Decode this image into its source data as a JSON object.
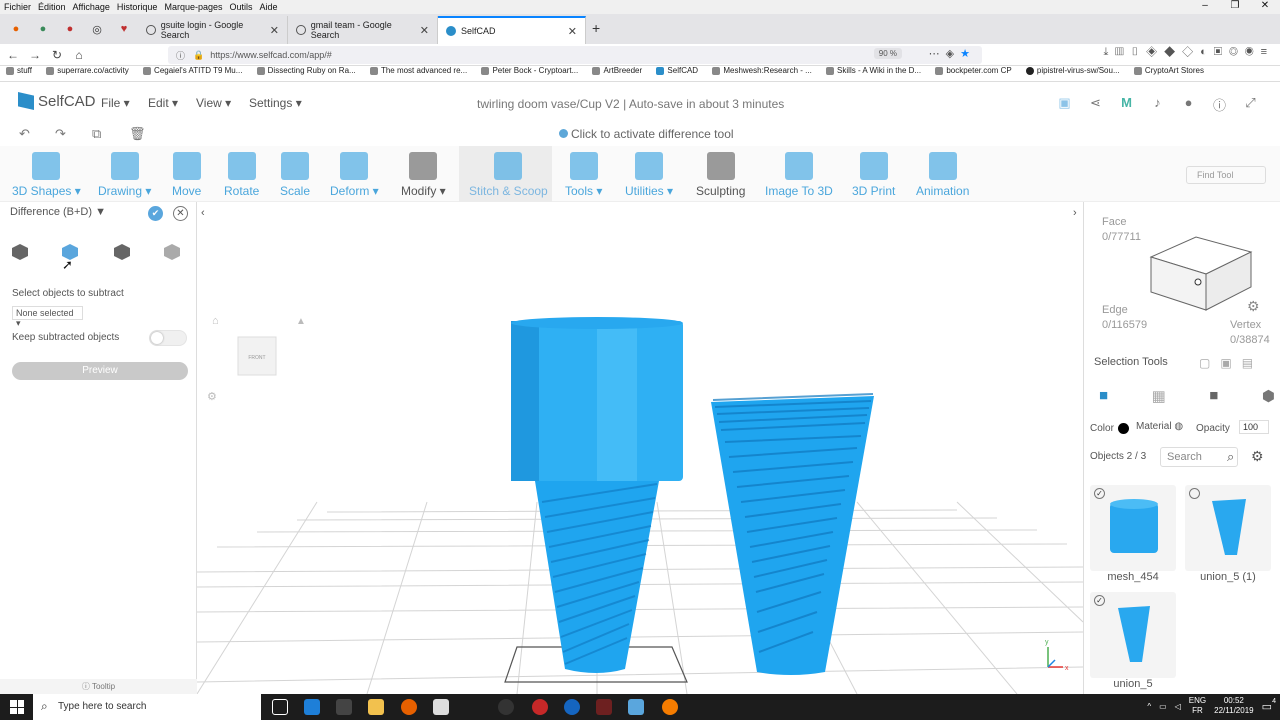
{
  "menubar": {
    "items": [
      "Fichier",
      "Édition",
      "Affichage",
      "Historique",
      "Marque-pages",
      "Outils",
      "Aide"
    ]
  },
  "tabs": [
    {
      "label": "gsuite login - Google Search"
    },
    {
      "label": "gmail team - Google Search"
    },
    {
      "label": "SelfCAD"
    }
  ],
  "navbar": {
    "url": "https://www.selfcad.com/app/#",
    "zoom": "90 %"
  },
  "bookmarks": [
    "stuff",
    "superrare.co/activity",
    "Cegaiel's ATITD T9 Mu...",
    "Dissecting Ruby on Ra...",
    "The most advanced re...",
    "Peter Bock - Cryptoart...",
    "ArtBreeder",
    "SelfCAD",
    "Meshwesh:Research - ...",
    "Skills - A Wiki in the D...",
    "bockpeter.com CP",
    "pipistrel-virus-sw/Sou...",
    "CryptoArt Stores"
  ],
  "app": {
    "logo": "SelfCAD",
    "menus": [
      "File",
      "Edit",
      "View",
      "Settings"
    ],
    "doc_title": "twirling doom vase/Cup V2",
    "autosave": "Auto-save in about 3 minutes",
    "hint": "Click to activate difference tool"
  },
  "tools": [
    "3D Shapes",
    "Drawing",
    "Move",
    "Rotate",
    "Scale",
    "Deform",
    "Modify",
    "Stitch & Scoop",
    "Tools",
    "Utilities",
    "Sculpting",
    "Image To 3D",
    "3D Print",
    "Animation"
  ],
  "find_tool_placeholder": "Find Tool",
  "left_panel": {
    "title": "Difference (B+D)",
    "select_label": "Select objects to subtract",
    "dropdown": "None selected",
    "keep_label": "Keep subtracted objects",
    "keep_value": false,
    "preview": "Preview",
    "tooltip": "Tooltip"
  },
  "viewport": {
    "front_label": "FRONT",
    "axis_y": "y",
    "axis_x": "x"
  },
  "right_panel": {
    "face_label": "Face",
    "face_count": "0/77711",
    "edge_label": "Edge",
    "edge_count": "0/116579",
    "vertex_label": "Vertex",
    "vertex_count": "0/38874",
    "selection_tools": "Selection Tools",
    "color_label": "Color",
    "color": "#000000",
    "material_label": "Material",
    "opacity_label": "Opacity",
    "opacity": "100",
    "objects_label": "Objects 2 / 3",
    "search_placeholder": "Search",
    "objects": [
      {
        "name": "mesh_454",
        "selected": true
      },
      {
        "name": "union_5 (1)",
        "selected": false
      },
      {
        "name": "union_5",
        "selected": true
      }
    ]
  },
  "accent_color": "#33a3e6",
  "taskbar": {
    "search_placeholder": "Type here to search",
    "lang": "ENG",
    "region": "FR",
    "time": "00:52",
    "date": "22/11/2019",
    "notifications": "4"
  }
}
